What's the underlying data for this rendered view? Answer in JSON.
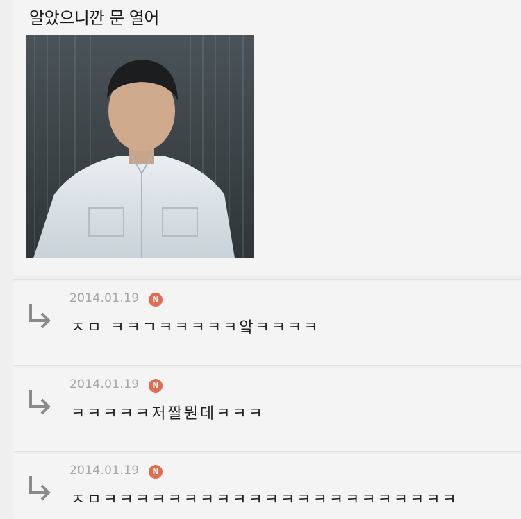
{
  "post": {
    "text": "알았으니깐 문 열어",
    "photo_icon": "rain-photo"
  },
  "replies": [
    {
      "date": "2014.01.19",
      "badge": "N",
      "text": "ㅈㅁ ㅋㅋㄱㅋㅋㅋㅋㅋ앜ㅋㅋㅋㅋ"
    },
    {
      "date": "2014.01.19",
      "badge": "N",
      "text": "ㅋㅋㅋㅋㅋ저짤뭔데ㅋㅋㅋ"
    },
    {
      "date": "2014.01.19",
      "badge": "N",
      "text": "ㅈㅁㅋㅋㅋㅋㅋㅋㅋㅋㅋㅋㅋㅋㅋㅋㅋㅋㅋㅋㅋㅋㅋㅋ"
    }
  ],
  "colors": {
    "badge": "#e06d52",
    "date": "#a6a6a6",
    "background": "#f4f4f4"
  }
}
